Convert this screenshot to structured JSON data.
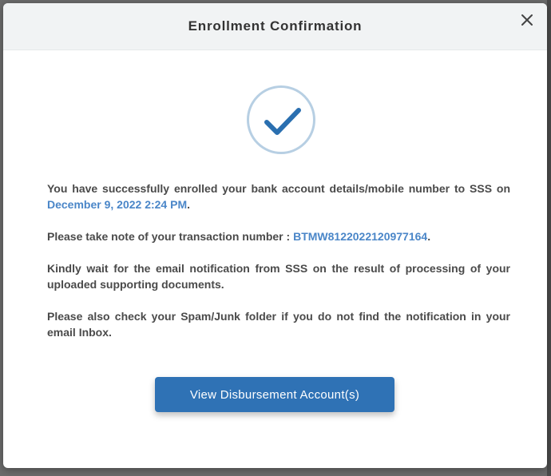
{
  "modal": {
    "title": "Enrollment Confirmation",
    "close_icon": "close-icon",
    "success_icon": "checkmark-icon",
    "paragraph1": {
      "text": "You have successfully enrolled your bank account details/mobile number to SSS on ",
      "date": "December 9, 2022 2:24 PM",
      "suffix": "."
    },
    "paragraph2": {
      "text": "Please take note of your transaction number : ",
      "transaction_number": "BTMW8122022120977164",
      "suffix": "."
    },
    "paragraph3": "Kindly wait for the email notification from SSS on the result of processing of your uploaded supporting documents.",
    "paragraph4": "Please also check your Spam/Junk folder if you do not find the notification in your email Inbox.",
    "button_label": "View Disbursement Account(s)"
  },
  "colors": {
    "accent": "#2f72b5",
    "link": "#4a86c8",
    "check": "#2a6fb0",
    "circle_border": "#b7cfe3",
    "header_bg": "#f1f3f4",
    "text": "#4a4a4a"
  }
}
